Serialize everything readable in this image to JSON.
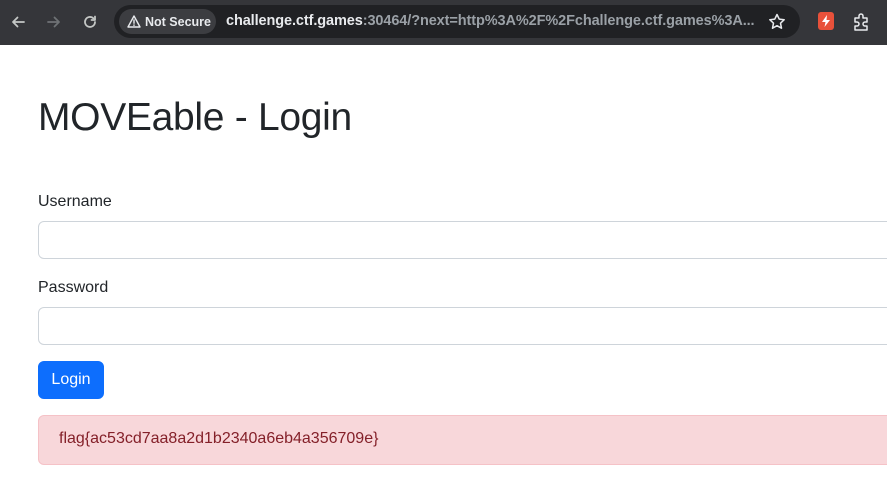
{
  "browser": {
    "security_label": "Not Secure",
    "url_host": "challenge.ctf.games",
    "url_rest": ":30464/?next=http%3A%2F%2Fchallenge.ctf.games%3A...",
    "icons": [
      "back-arrow-icon",
      "forward-arrow-icon",
      "reload-icon",
      "warning-icon",
      "star-icon",
      "extension-icon",
      "puzzle-icon"
    ]
  },
  "page": {
    "title": "MOVEable - Login",
    "username_label": "Username",
    "username_value": "",
    "password_label": "Password",
    "password_value": "",
    "login_button": "Login",
    "alert_text": "flag{ac53cd7aa8a2d1b2340a6eb4a356709e}"
  },
  "colors": {
    "toolbar": "#35363a",
    "primary_button": "#0d6efd",
    "alert_background": "#f8d7da",
    "alert_text": "#842029"
  }
}
